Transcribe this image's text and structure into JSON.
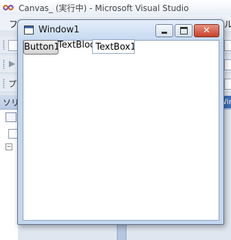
{
  "vs": {
    "title": "Canvas_ (実行中) - Microsoft Visual Studio",
    "menus": [
      "フ",
      "ル"
    ],
    "toolbar_chars": [
      "プ"
    ],
    "panel_label": "ソリ",
    "right_tab_label": "Wir"
  },
  "window": {
    "title": "Window1",
    "controls": {
      "close_glyph": "✕"
    },
    "content": {
      "button_label": "Button1",
      "textblock_text": "TextBlock",
      "textbox_value": "TextBox1"
    }
  },
  "colors": {
    "close_button": "#c7412b",
    "title_bar": "#c8daf0",
    "panel_tab": "#3d6fb7"
  }
}
